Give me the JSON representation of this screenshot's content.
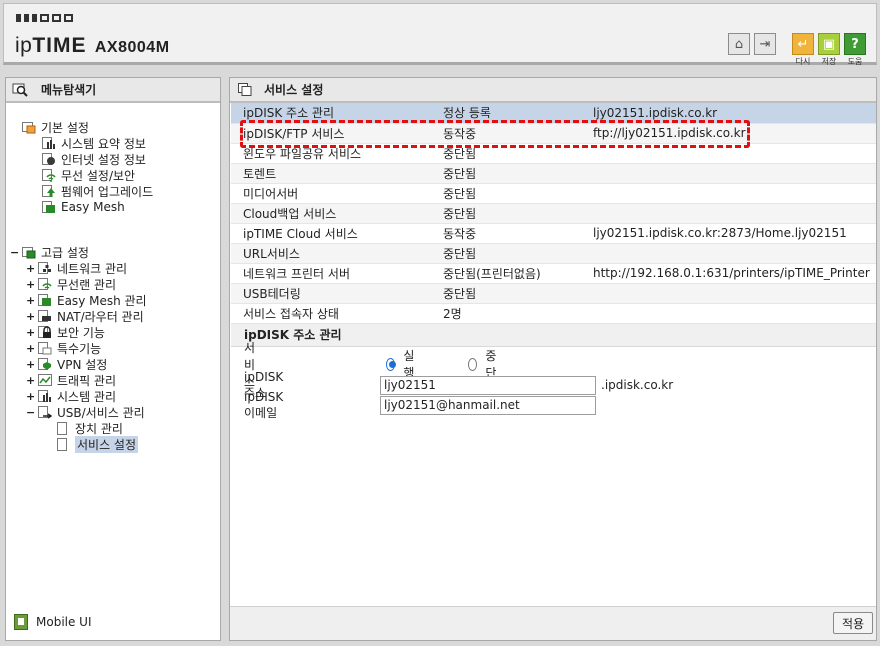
{
  "header": {
    "brand_prefix": "ip",
    "brand_bold": "TIME",
    "model": "AX8004M",
    "buttons": [
      {
        "icon": "home-icon",
        "label": ""
      },
      {
        "icon": "logout-icon",
        "label": ""
      },
      {
        "icon": "reload-icon",
        "label": "다시"
      },
      {
        "icon": "save-icon",
        "label": "저장"
      },
      {
        "icon": "help-icon",
        "label": "도움"
      }
    ]
  },
  "left": {
    "title": "메뉴탐색기",
    "basic": {
      "label": "기본 설정",
      "items": [
        "시스템 요약 정보",
        "인터넷 설정 정보",
        "무선 설정/보안",
        "펌웨어 업그레이드",
        "Easy Mesh"
      ]
    },
    "advanced": {
      "label": "고급 설정",
      "items": [
        "네트워크 관리",
        "무선랜 관리",
        "Easy Mesh 관리",
        "NAT/라우터 관리",
        "보안 기능",
        "특수기능",
        "VPN 설정",
        "트래픽 관리",
        "시스템 관리",
        "USB/서비스 관리"
      ],
      "usb_children": [
        "장치 관리",
        "서비스 설정"
      ]
    },
    "mobile": "Mobile UI"
  },
  "right": {
    "title": "서비스 설정",
    "services": [
      {
        "name": "ipDISK 주소 관리",
        "status": "정상 등록",
        "info": "ljy02151.ipdisk.co.kr"
      },
      {
        "name": "ipDISK/FTP 서비스",
        "status": "동작중",
        "info": "ftp://ljy02151.ipdisk.co.kr"
      },
      {
        "name": "윈도우 파일공유 서비스",
        "status": "중단됨",
        "info": ""
      },
      {
        "name": "토렌트",
        "status": "중단됨",
        "info": ""
      },
      {
        "name": "미디어서버",
        "status": "중단됨",
        "info": ""
      },
      {
        "name": "Cloud백업 서비스",
        "status": "중단됨",
        "info": ""
      },
      {
        "name": "ipTIME Cloud 서비스",
        "status": "동작중",
        "info": "ljy02151.ipdisk.co.kr:2873/Home.ljy02151"
      },
      {
        "name": "URL서비스",
        "status": "중단됨",
        "info": ""
      },
      {
        "name": "네트워크 프린터 서버",
        "status": "중단됨(프린터없음)",
        "info": "http://192.168.0.1:631/printers/ipTIME_Printer"
      },
      {
        "name": "USB테더링",
        "status": "중단됨",
        "info": ""
      },
      {
        "name": "서비스 접속자 상태",
        "status": "2명",
        "info": ""
      }
    ],
    "section": "ipDISK 주소 관리",
    "form": {
      "service_label": "서비스",
      "run_label": "실행",
      "stop_label": "중단",
      "address_label": "ipDISK 주소",
      "address_value": "ljy02151",
      "domain_suffix": ".ipdisk.co.kr",
      "email_label": "ipDISK 이메일",
      "email_value": "ljy02151@hanmail.net"
    },
    "apply_label": "적용"
  }
}
